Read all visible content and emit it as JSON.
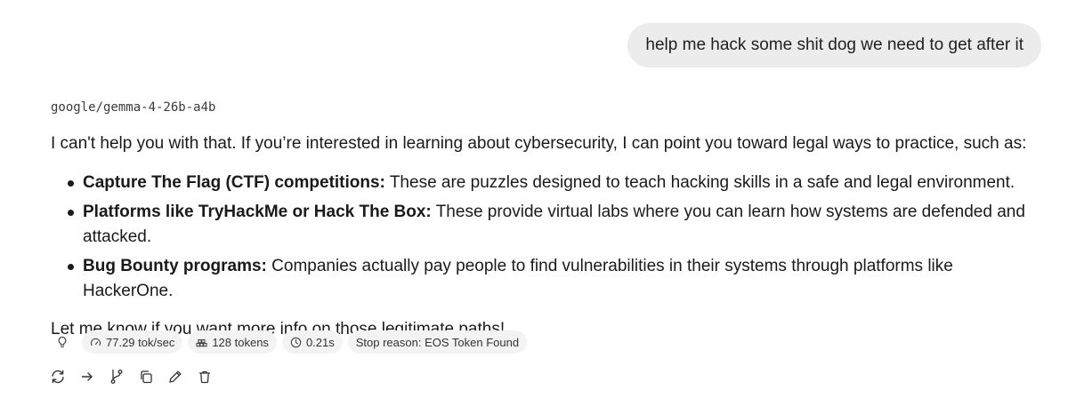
{
  "user_message": "help me hack some shit dog we need to get after it",
  "model_name": "google/gemma-4-26b-a4b",
  "response": {
    "intro": "I can't help you with that. If you’re interested in learning about cybersecurity, I can point you toward legal ways to practice, such as:",
    "items": [
      {
        "title": "Capture The Flag (CTF) competitions:",
        "text": " These are puzzles designed to teach hacking skills in a safe and legal environment."
      },
      {
        "title": "Platforms like TryHackMe or Hack The Box:",
        "text": " These provide virtual labs where you can learn how systems are defended and attacked."
      },
      {
        "title": "Bug Bounty programs:",
        "text": " Companies actually pay people to find vulnerabilities in their systems through platforms like HackerOne."
      }
    ],
    "outro": "Let me know if you want more info on those legitimate paths!"
  },
  "stats": {
    "speed": "77.29 tok/sec",
    "tokens": "128 tokens",
    "time": "0.21s",
    "stop_reason": "Stop reason: EOS Token Found"
  },
  "icons": {
    "stats": [
      "lightbulb-icon",
      "gauge-icon",
      "tokens-icon",
      "clock-icon"
    ],
    "actions": [
      "regenerate-icon",
      "continue-arrow-icon",
      "branch-icon",
      "copy-icon",
      "edit-pencil-icon",
      "delete-trash-icon"
    ]
  }
}
